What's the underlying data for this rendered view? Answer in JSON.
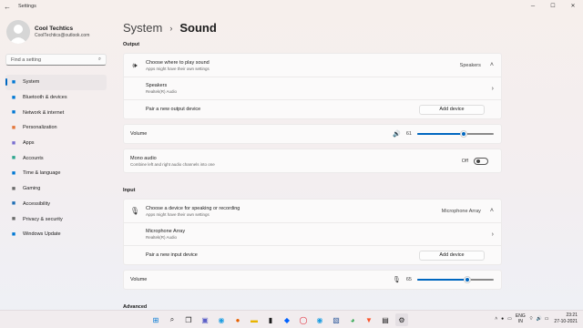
{
  "window": {
    "title": "Settings"
  },
  "profile": {
    "name": "Cool Techtics",
    "email": "CoolTechtics@outlook.com"
  },
  "search": {
    "placeholder": "Find a setting"
  },
  "nav": [
    {
      "label": "System",
      "icon": "monitor-icon",
      "color": "#0078d4",
      "active": true
    },
    {
      "label": "Bluetooth & devices",
      "icon": "bluetooth-icon",
      "color": "#0078d4"
    },
    {
      "label": "Network & internet",
      "icon": "wifi-icon",
      "color": "#0078d4"
    },
    {
      "label": "Personalization",
      "icon": "brush-icon",
      "color": "#e3763a"
    },
    {
      "label": "Apps",
      "icon": "apps-icon",
      "color": "#7a6fd0"
    },
    {
      "label": "Accounts",
      "icon": "person-icon",
      "color": "#2ca58d"
    },
    {
      "label": "Time & language",
      "icon": "globe-clock-icon",
      "color": "#0078d4"
    },
    {
      "label": "Gaming",
      "icon": "gamepad-icon",
      "color": "#6a6a6a"
    },
    {
      "label": "Accessibility",
      "icon": "accessibility-icon",
      "color": "#1f6fb5"
    },
    {
      "label": "Privacy & security",
      "icon": "shield-icon",
      "color": "#6a6a6a"
    },
    {
      "label": "Windows Update",
      "icon": "update-icon",
      "color": "#0078d4"
    }
  ],
  "breadcrumb": {
    "parent": "System",
    "current": "Sound"
  },
  "output": {
    "heading": "Output",
    "choose_title": "Choose where to play sound",
    "choose_sub": "Apps might have their own settings",
    "choose_value": "Speakers",
    "device_name": "Speakers",
    "device_sub": "Realtek(R) Audio",
    "pair_label": "Pair a new output device",
    "add_button": "Add device",
    "volume_label": "Volume",
    "volume_value": "61",
    "volume_level": 0.61,
    "mono_title": "Mono audio",
    "mono_sub": "Combine left and right audio channels into one",
    "mono_state": "Off"
  },
  "input": {
    "heading": "Input",
    "choose_title": "Choose a device for speaking or recording",
    "choose_sub": "Apps might have their own settings",
    "choose_value": "Microphone Array",
    "device_name": "Microphone Array",
    "device_sub": "Realtek(R) Audio",
    "pair_label": "Pair a new input device",
    "add_button": "Add device",
    "volume_label": "Volume",
    "volume_value": "65",
    "volume_level": 0.65
  },
  "advanced": {
    "heading": "Advanced"
  },
  "taskbar": {
    "lang_top": "ENG",
    "lang_bottom": "IN",
    "time": "23:21",
    "date": "27-10-2021"
  }
}
